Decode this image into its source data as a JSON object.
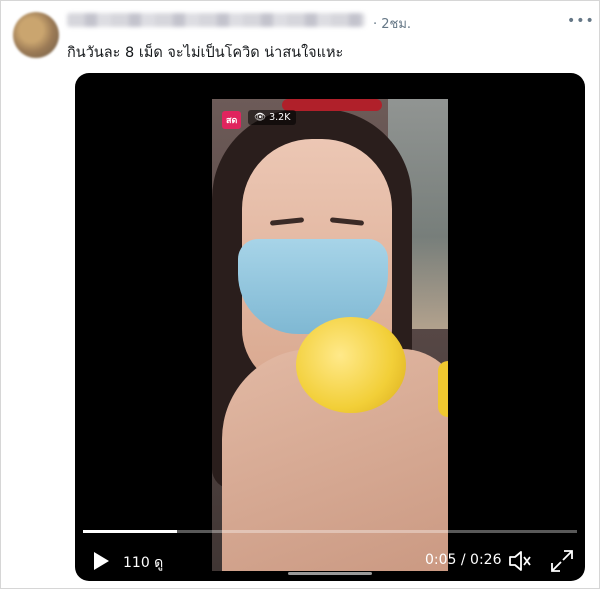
{
  "tweet": {
    "timestamp": "· 2ชม.",
    "more_icon": "more-dots-icon",
    "text": "กินวันละ 8 เม็ด จะไม่เป็นโควิด น่าสนใจแหะ"
  },
  "video": {
    "live_badge": "สด",
    "viewer_count": "3.2K",
    "views_label": "110 ดู",
    "time": "0:05 / 0:26",
    "progress_fraction": 0.19,
    "icons": [
      "play-icon",
      "eye-icon",
      "mute-icon",
      "fullscreen-icon"
    ]
  }
}
